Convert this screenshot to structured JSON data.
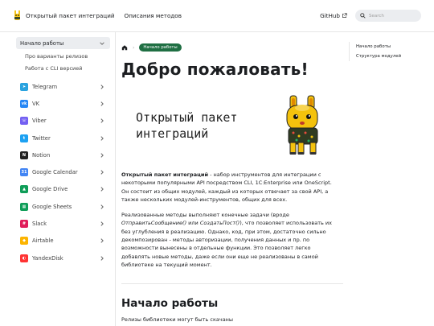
{
  "navbar": {
    "title": "Открытый пакет интеграций",
    "methods_link": "Описания методов",
    "github": "GitHub",
    "search_placeholder": "Search"
  },
  "sidebar": {
    "group_label": "Начало работы",
    "sub_items": [
      "Про варианты релизов",
      "Работа с CLI версией"
    ],
    "items": [
      {
        "label": "Telegram",
        "icon": "telegram-icon",
        "color": "#2aa3df"
      },
      {
        "label": "VK",
        "icon": "vk-icon",
        "color": "#2787f5"
      },
      {
        "label": "Viber",
        "icon": "viber-icon",
        "color": "#7360f2"
      },
      {
        "label": "Twitter",
        "icon": "twitter-icon",
        "color": "#1da1f2"
      },
      {
        "label": "Notion",
        "icon": "notion-icon",
        "color": "#222222"
      },
      {
        "label": "Google Calendar",
        "icon": "google-calendar-icon",
        "color": "#4285f4"
      },
      {
        "label": "Google Drive",
        "icon": "google-drive-icon",
        "color": "#0f9d58"
      },
      {
        "label": "Google Sheets",
        "icon": "google-sheets-icon",
        "color": "#0f9d58"
      },
      {
        "label": "Slack",
        "icon": "slack-icon",
        "color": "#e01e5a"
      },
      {
        "label": "Airtable",
        "icon": "airtable-icon",
        "color": "#fcb400"
      },
      {
        "label": "YandexDisk",
        "icon": "yandexdisk-icon",
        "color": "#ff3333"
      }
    ]
  },
  "breadcrumb": {
    "current": "Начало работы"
  },
  "main": {
    "title": "Добро пожаловать!",
    "hero_line1": "Открытый пакет",
    "hero_line2": "интеграций",
    "para1_bold": "Открытый пакет интеграций",
    "para1_rest": " - набор инструментов для интеграции с некоторыми популярными API посредством CLI, 1C:Enterprise или OneScript. Он состоит из общих модулей, каждый из которых отвечает за свой API, а также нескольких модулей-инструментов, общих для всех.",
    "para2_a": "Реализованные методы выполняют конечные задачи (вроде ",
    "para2_i1": "ОтправитьСообщение()",
    "para2_b": " или ",
    "para2_i2": "СоздатьПост()",
    "para2_c": "), что позволяет использовать их без углубления в реализацию. Однако, код, при этом, достаточно сильно декомпозирован - методы авторизации, получения данных и пр. по возможности вынесены в отдельные функции. Это позволяет легко добавлять новые методы, даже если они еще не реализованы в самой библиотеке на текущий момент.",
    "section_title": "Начало работы",
    "section_cut": "Релизы библиотеки могут быть скачаны"
  },
  "toc": {
    "items": [
      "Начало работы",
      "Структура модулей"
    ]
  },
  "colors": {
    "accent": "#1f6f43",
    "sidebar_active": "#ebedf0"
  }
}
